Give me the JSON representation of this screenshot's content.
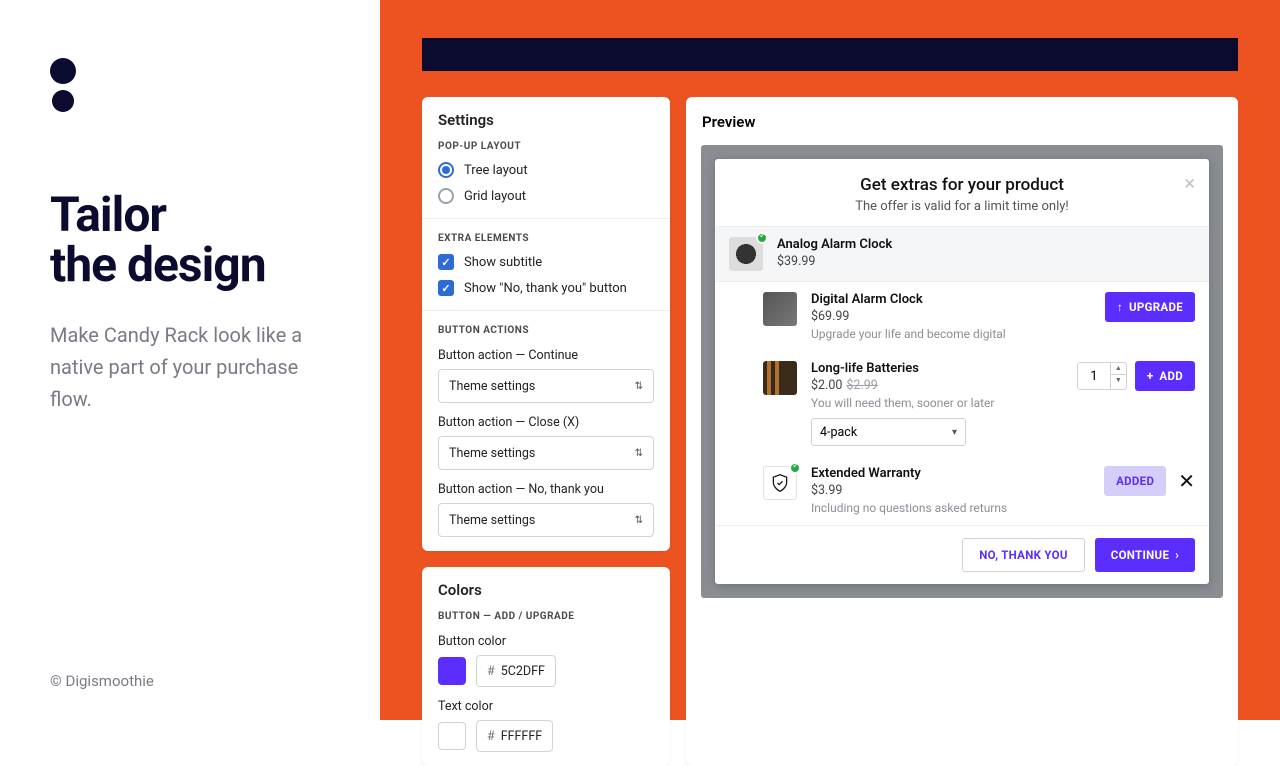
{
  "marketing": {
    "headline_l1": "Tailor",
    "headline_l2": "the design",
    "subtitle": "Make Candy Rack look like a native part of your purchase flow.",
    "copyright": "© Digismoothie"
  },
  "settings": {
    "title": "Settings",
    "layout_label": "POP-UP LAYOUT",
    "layout_options": [
      "Tree layout",
      "Grid layout"
    ],
    "layout_selected": 0,
    "extra_label": "EXTRA ELEMENTS",
    "extra_opts": [
      {
        "label": "Show subtitle",
        "checked": true
      },
      {
        "label": "Show \"No, thank you\" button",
        "checked": true
      }
    ],
    "btn_actions_label": "BUTTON ACTIONS",
    "btn_actions": [
      {
        "label": "Button action — Continue",
        "value": "Theme settings"
      },
      {
        "label": "Button action — Close (X)",
        "value": "Theme settings"
      },
      {
        "label": "Button action — No, thank you",
        "value": "Theme settings"
      }
    ],
    "colors_title": "Colors",
    "colors_section": "BUTTON — ADD / UPGRADE",
    "button_color_label": "Button color",
    "button_color": "5C2DFF",
    "text_color_label": "Text color",
    "text_color": "FFFFFF"
  },
  "preview": {
    "title": "Preview",
    "modal": {
      "title": "Get extras for your product",
      "subtitle": "The offer is valid for a limit time only!",
      "main_product": {
        "name": "Analog Alarm Clock",
        "price": "$39.99"
      },
      "offers": [
        {
          "name": "Digital Alarm Clock",
          "price": "$69.99",
          "desc": "Upgrade your life and become digital",
          "cta": "UPGRADE",
          "type": "upgrade"
        },
        {
          "name": "Long-life Batteries",
          "price": "$2.00",
          "compare": "$2.99",
          "desc": "You will need them, sooner or later",
          "cta": "ADD",
          "type": "add",
          "qty": "1",
          "variant": "4-pack"
        },
        {
          "name": "Extended Warranty",
          "price": "$3.99",
          "desc": "Including no questions asked returns",
          "cta": "ADDED",
          "type": "added"
        }
      ],
      "no_thanks": "NO, THANK YOU",
      "continue": "CONTINUE"
    }
  }
}
